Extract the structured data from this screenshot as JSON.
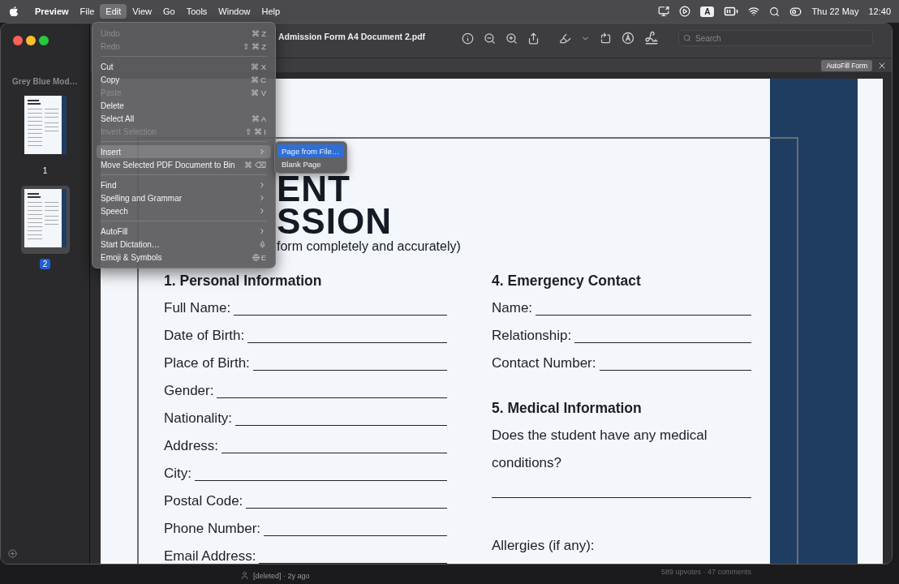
{
  "menubar": {
    "items": [
      {
        "label": "Preview",
        "kind": "app",
        "selected": false
      },
      {
        "label": "File",
        "kind": "menu",
        "selected": false
      },
      {
        "label": "Edit",
        "kind": "menu",
        "selected": true
      },
      {
        "label": "View",
        "kind": "menu",
        "selected": false
      },
      {
        "label": "Go",
        "kind": "menu",
        "selected": false
      },
      {
        "label": "Tools",
        "kind": "menu",
        "selected": false
      },
      {
        "label": "Window",
        "kind": "menu",
        "selected": false
      },
      {
        "label": "Help",
        "kind": "menu",
        "selected": false
      }
    ],
    "input_source": "A",
    "date": "Thu 22 May",
    "time": "12:40"
  },
  "window": {
    "title": "Admission Form A4 Document 2.pdf",
    "search": {
      "placeholder": "Search"
    },
    "autofill_button": "AutoFill Form"
  },
  "sidebar": {
    "title": "Grey Blue Mod…",
    "pages": [
      {
        "label": "1",
        "selected": false
      },
      {
        "label": "2",
        "selected": true
      }
    ]
  },
  "document": {
    "heading": [
      "ENT",
      "SSION"
    ],
    "subtitle": "form completely and accurately)",
    "columns": [
      [
        {
          "kind": "heading",
          "text": "1. Personal Information"
        },
        {
          "kind": "field",
          "text": "Full Name:"
        },
        {
          "kind": "field",
          "text": "Date of Birth:"
        },
        {
          "kind": "field",
          "text": "Place of Birth:"
        },
        {
          "kind": "field",
          "text": "Gender:"
        },
        {
          "kind": "field",
          "text": "Nationality:"
        },
        {
          "kind": "field",
          "text": "Address:"
        },
        {
          "kind": "field",
          "text": "City:"
        },
        {
          "kind": "field",
          "text": "Postal Code:"
        },
        {
          "kind": "field",
          "text": "Phone Number:"
        },
        {
          "kind": "field",
          "text": "Email Address:"
        }
      ],
      [
        {
          "kind": "heading",
          "text": "4. Emergency Contact"
        },
        {
          "kind": "field",
          "text": "Name:"
        },
        {
          "kind": "field",
          "text": "Relationship:"
        },
        {
          "kind": "field",
          "text": "Contact Number:"
        },
        {
          "kind": "heading",
          "text": "5. Medical Information"
        },
        {
          "kind": "text",
          "text": "Does the student have any medical"
        },
        {
          "kind": "text",
          "text": "conditions?"
        },
        {
          "kind": "blank"
        },
        {
          "kind": "text",
          "text": "Allergies (if any):"
        }
      ]
    ]
  },
  "edit_menu": {
    "items": [
      {
        "kind": "item",
        "label": "Undo",
        "shortcut": "⌘ Z",
        "disabled": true,
        "selected": false,
        "submenu": false
      },
      {
        "kind": "item",
        "label": "Redo",
        "shortcut": "⇧ ⌘ Z",
        "disabled": true,
        "selected": false,
        "submenu": false
      },
      {
        "kind": "separator"
      },
      {
        "kind": "item",
        "label": "Cut",
        "shortcut": "⌘ X",
        "disabled": false,
        "selected": false,
        "submenu": false
      },
      {
        "kind": "item",
        "label": "Copy",
        "shortcut": "⌘ C",
        "disabled": false,
        "selected": false,
        "submenu": false
      },
      {
        "kind": "item",
        "label": "Paste",
        "shortcut": "⌘ V",
        "disabled": true,
        "selected": false,
        "submenu": false
      },
      {
        "kind": "item",
        "label": "Delete",
        "disabled": false,
        "selected": false,
        "submenu": false
      },
      {
        "kind": "item",
        "label": "Select All",
        "shortcut": "⌘ A",
        "disabled": false,
        "selected": false,
        "submenu": false
      },
      {
        "kind": "item",
        "label": "Invert Selection",
        "shortcut": "⇧ ⌘ I",
        "disabled": true,
        "selected": false,
        "submenu": false
      },
      {
        "kind": "separator"
      },
      {
        "kind": "item",
        "label": "Insert",
        "disabled": false,
        "selected": true,
        "submenu": true
      },
      {
        "kind": "item",
        "label": "Move Selected PDF Document to Bin",
        "shortcut": "⌘ ⌫",
        "disabled": false,
        "selected": false,
        "submenu": false
      },
      {
        "kind": "separator"
      },
      {
        "kind": "item",
        "label": "Find",
        "disabled": false,
        "selected": false,
        "submenu": true
      },
      {
        "kind": "item",
        "label": "Spelling and Grammar",
        "disabled": false,
        "selected": false,
        "submenu": true
      },
      {
        "kind": "item",
        "label": "Speech",
        "disabled": false,
        "selected": false,
        "submenu": true
      },
      {
        "kind": "separator"
      },
      {
        "kind": "item",
        "label": "AutoFill",
        "disabled": false,
        "selected": false,
        "submenu": true
      },
      {
        "kind": "dictation",
        "label": "Start Dictation…",
        "disabled": false,
        "selected": false,
        "submenu": false
      },
      {
        "kind": "emoji",
        "label": "Emoji & Symbols",
        "shortcut": "E",
        "disabled": false,
        "selected": false,
        "submenu": false
      }
    ]
  },
  "insert_submenu": {
    "items": [
      {
        "label": "Page from File…",
        "selected": true
      },
      {
        "label": "Blank Page",
        "selected": false
      }
    ]
  },
  "background_post": {
    "author": "[deleted] · 2y ago",
    "stats": "589 upvotes · 47 comments"
  }
}
